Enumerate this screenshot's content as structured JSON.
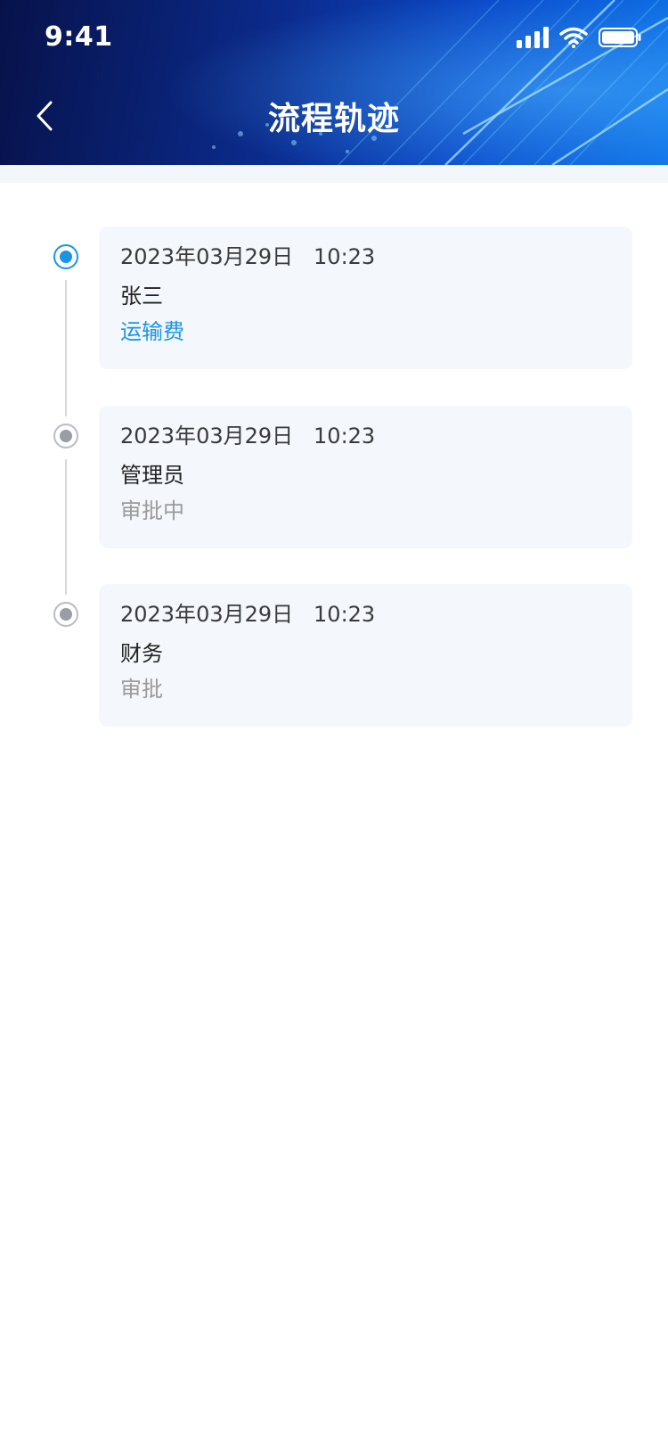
{
  "status_bar": {
    "time": "9:41",
    "icons": [
      "signal-icon",
      "wifi-icon",
      "battery-icon"
    ]
  },
  "header": {
    "title": "流程轨迹",
    "back_icon": "chevron-left-icon"
  },
  "colors": {
    "accent": "#1a95e6",
    "muted": "#9a9a9a",
    "card_bg": "#f4f7fc",
    "header_dark": "#07124a",
    "header_bright": "#0a6fe6"
  },
  "timeline": {
    "items": [
      {
        "datetime": "2023年03月29日   10:23",
        "name": "张三",
        "status": "运输费",
        "state": "active"
      },
      {
        "datetime": "2023年03月29日   10:23",
        "name": "管理员",
        "status": "审批中",
        "state": "pending"
      },
      {
        "datetime": "2023年03月29日   10:23",
        "name": "财务",
        "status": "审批",
        "state": "pending"
      }
    ]
  }
}
